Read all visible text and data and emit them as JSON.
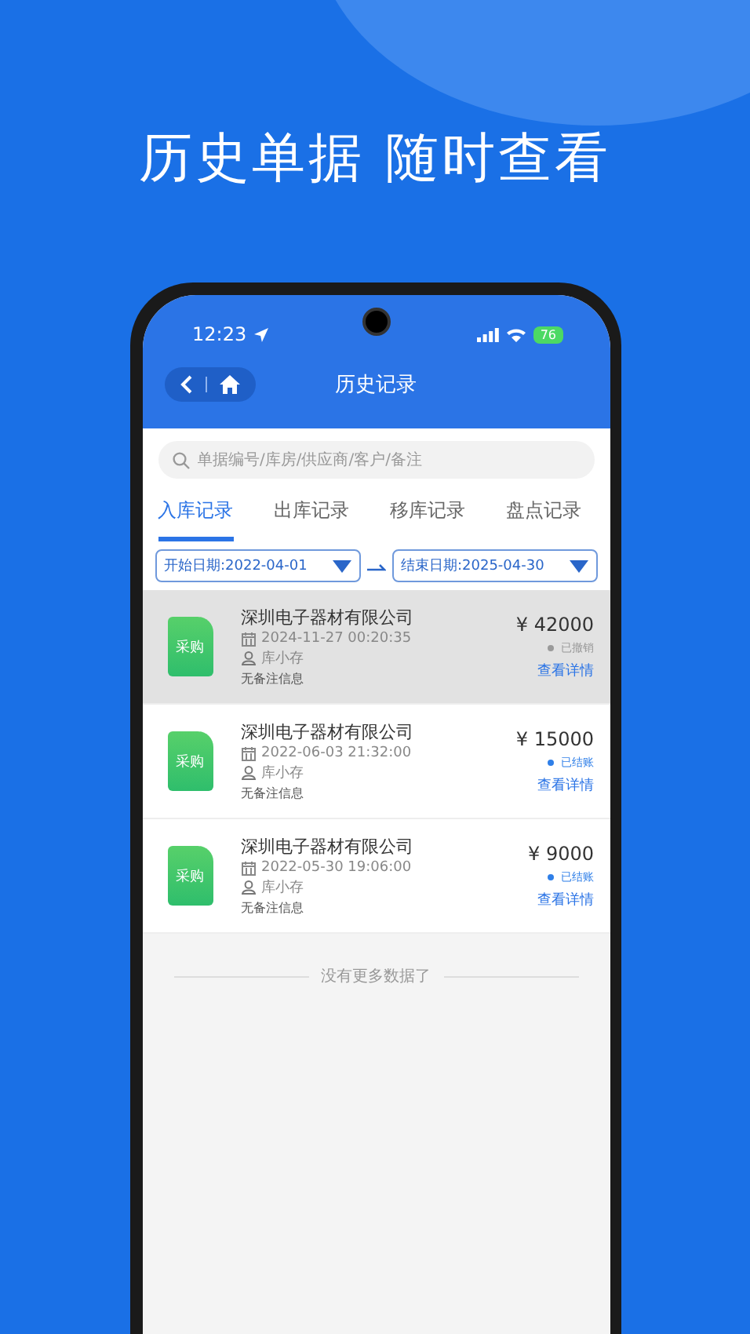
{
  "headline": "历史单据 随时查看",
  "status_bar": {
    "time": "12:23",
    "battery": "76"
  },
  "nav": {
    "title": "历史记录"
  },
  "search": {
    "placeholder": "单据编号/库房/供应商/客户/备注"
  },
  "tabs": [
    {
      "label": "入库记录",
      "selected": true
    },
    {
      "label": "出库记录",
      "selected": false
    },
    {
      "label": "移库记录",
      "selected": false
    },
    {
      "label": "盘点记录",
      "selected": false
    }
  ],
  "date_range": {
    "start": "开始日期:2022-04-01",
    "end": "结束日期:2025-04-30"
  },
  "records": [
    {
      "badge": "采购",
      "company": "深圳电子器材有限公司",
      "time": "2024-11-27 00:20:35",
      "user": "库小存",
      "note": "无备注信息",
      "amount": "¥ 42000",
      "status": "已撤销",
      "color": "#9a9a9a",
      "link": "查看详情",
      "selected": true
    },
    {
      "badge": "采购",
      "company": "深圳电子器材有限公司",
      "time": "2022-06-03 21:32:00",
      "user": "库小存",
      "note": "无备注信息",
      "amount": "¥ 15000",
      "status": "已结账",
      "color": "#2f7fe8",
      "link": "查看详情",
      "selected": false
    },
    {
      "badge": "采购",
      "company": "深圳电子器材有限公司",
      "time": "2022-05-30 19:06:00",
      "user": "库小存",
      "note": "无备注信息",
      "amount": "¥ 9000",
      "status": "已结账",
      "color": "#2f7fe8",
      "link": "查看详情",
      "selected": false
    }
  ],
  "end_note": "没有更多数据了"
}
